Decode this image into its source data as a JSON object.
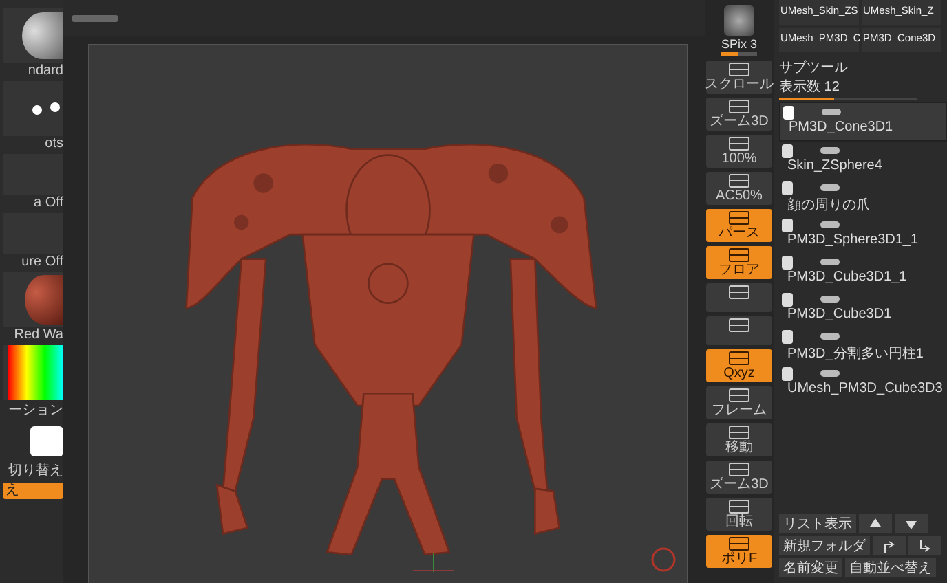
{
  "left_panel": [
    {
      "kind": "brush",
      "label": "ndard"
    },
    {
      "kind": "dots",
      "label": "ots"
    },
    {
      "kind": "plain",
      "label": "a Off"
    },
    {
      "kind": "plain",
      "label": "ure Off"
    },
    {
      "kind": "material",
      "label": "Red Wa"
    },
    {
      "kind": "color",
      "label": "ーション"
    },
    {
      "kind": "swatch",
      "label": "切り替え"
    },
    {
      "kind": "orange",
      "label": "え"
    }
  ],
  "toolbar": {
    "spix": {
      "label": "SPix 3",
      "level": 0.45
    },
    "tiles": [
      {
        "label": "スクロール",
        "active": false
      },
      {
        "label": "ズーム3D",
        "active": false
      },
      {
        "label": "100%",
        "active": false
      },
      {
        "label": "AC50%",
        "active": false
      },
      {
        "label": "パース",
        "active": true
      },
      {
        "label": "フロア",
        "active": true
      },
      {
        "active": false
      },
      {
        "active": false
      },
      {
        "label": "Qxyz",
        "active": true
      },
      {
        "label": "フレーム",
        "active": false
      },
      {
        "label": "移動",
        "active": false
      },
      {
        "label": "ズーム3D",
        "active": false
      },
      {
        "label": "回転",
        "active": false
      },
      {
        "label": "ポリF",
        "active": true
      }
    ]
  },
  "tool_thumbnails": [
    "UMesh_Skin_ZS",
    "UMesh_Skin_Z",
    "UMesh_PM3D_C",
    "PM3D_Cone3D"
  ],
  "subtool": {
    "title": "サブツール",
    "count": "表示数 12",
    "level": 0.4,
    "items": [
      {
        "name": "PM3D_Cone3D1",
        "selected": true
      },
      {
        "name": "Skin_ZSphere4",
        "selected": false
      },
      {
        "name": "顔の周りの爪",
        "selected": false
      },
      {
        "name": "PM3D_Sphere3D1_1",
        "selected": false
      },
      {
        "name": "PM3D_Cube3D1_1",
        "selected": false
      },
      {
        "name": "PM3D_Cube3D1",
        "selected": false
      },
      {
        "name": "PM3D_分割多い円柱1",
        "selected": false
      },
      {
        "name": "UMesh_PM3D_Cube3D3",
        "selected": false
      }
    ],
    "buttons": [
      {
        "kind": "text",
        "label": "リスト表示"
      },
      {
        "kind": "up"
      },
      {
        "kind": "down"
      },
      {
        "kind": "text",
        "label": "新規フォルダ"
      },
      {
        "kind": "turn-right"
      },
      {
        "kind": "turn-down"
      },
      {
        "kind": "text",
        "label": "名前変更"
      },
      {
        "kind": "text",
        "label": "自動並べ替え"
      }
    ]
  }
}
